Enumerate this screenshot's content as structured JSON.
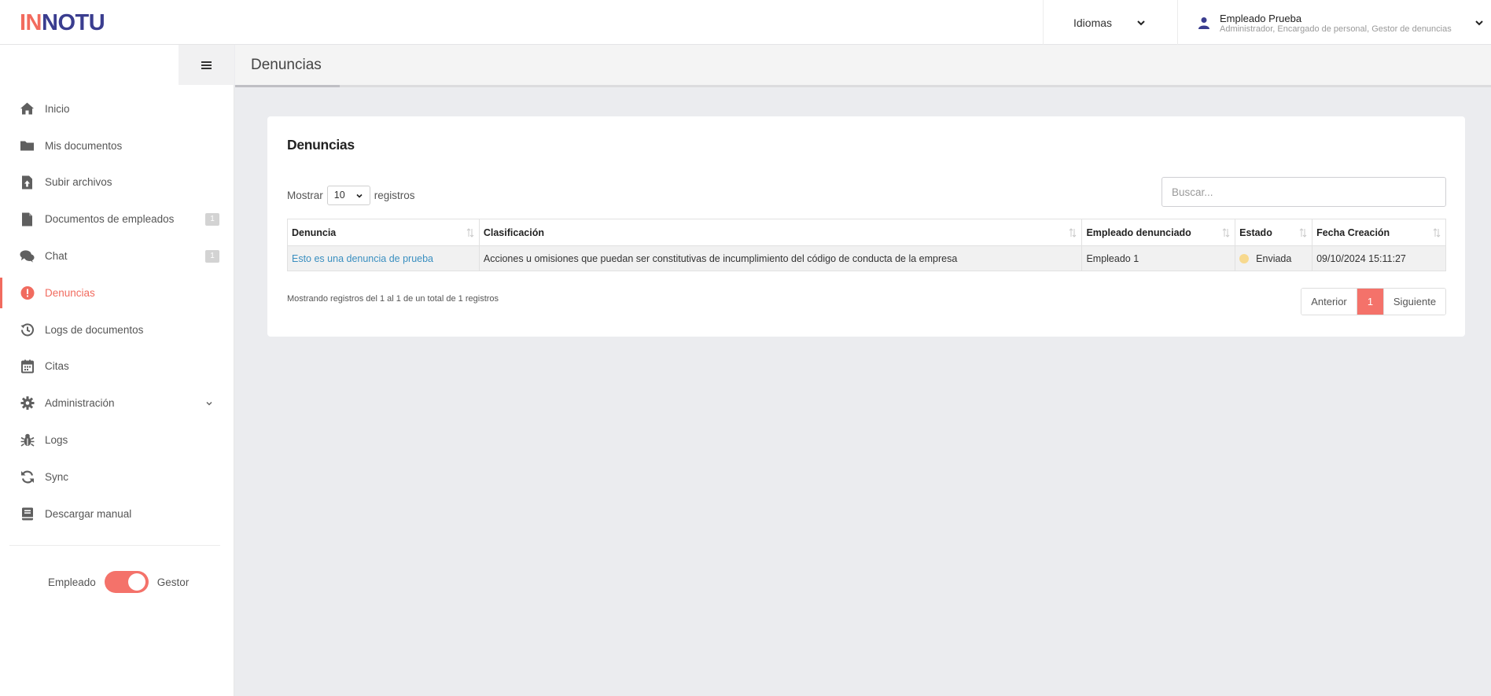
{
  "header": {
    "logo_prefix": "IN",
    "logo_rest": "NOTU",
    "language_label": "Idiomas",
    "user_name": "Empleado Prueba",
    "user_roles": "Administrador, Encargado de personal, Gestor de denuncias"
  },
  "sidebar": {
    "items": [
      {
        "label": "Inicio",
        "icon": "home-icon"
      },
      {
        "label": "Mis documentos",
        "icon": "folder-icon"
      },
      {
        "label": "Subir archivos",
        "icon": "file-upload-icon"
      },
      {
        "label": "Documentos de empleados",
        "icon": "file-icon",
        "badge": "1"
      },
      {
        "label": "Chat",
        "icon": "chat-icon",
        "badge": "1"
      },
      {
        "label": "Denuncias",
        "icon": "alert-circle-icon",
        "active": true
      },
      {
        "label": "Logs de documentos",
        "icon": "history-icon"
      },
      {
        "label": "Citas",
        "icon": "calendar-icon"
      },
      {
        "label": "Administración",
        "icon": "gear-icon",
        "has_submenu": true
      },
      {
        "label": "Logs",
        "icon": "bug-icon"
      },
      {
        "label": "Sync",
        "icon": "sync-icon"
      },
      {
        "label": "Descargar manual",
        "icon": "book-icon"
      }
    ],
    "mode_left": "Empleado",
    "mode_right": "Gestor"
  },
  "page": {
    "title": "Denuncias"
  },
  "card": {
    "title": "Denuncias",
    "show_label": "Mostrar",
    "page_size": "10",
    "records_label": "registros",
    "search_placeholder": "Buscar...",
    "columns": [
      "Denuncia",
      "Clasificación",
      "Empleado denunciado",
      "Estado",
      "Fecha Creación"
    ],
    "rows": [
      {
        "denuncia": "Esto es una denuncia de prueba",
        "clasificacion": "Acciones u omisiones que puedan ser constitutivas de incumplimiento del código de conducta de la empresa",
        "empleado": "Empleado 1",
        "estado": "Enviada",
        "fecha": "09/10/2024 15:11:27"
      }
    ],
    "info": "Mostrando registros del 1 al 1 de un total de 1 registros",
    "pager": {
      "prev": "Anterior",
      "current": "1",
      "next": "Siguiente"
    }
  },
  "colors": {
    "accent": "#f16b5f",
    "brand": "#3a3d8f",
    "link": "#3a8fc0",
    "status_sent": "#f7d98e"
  }
}
